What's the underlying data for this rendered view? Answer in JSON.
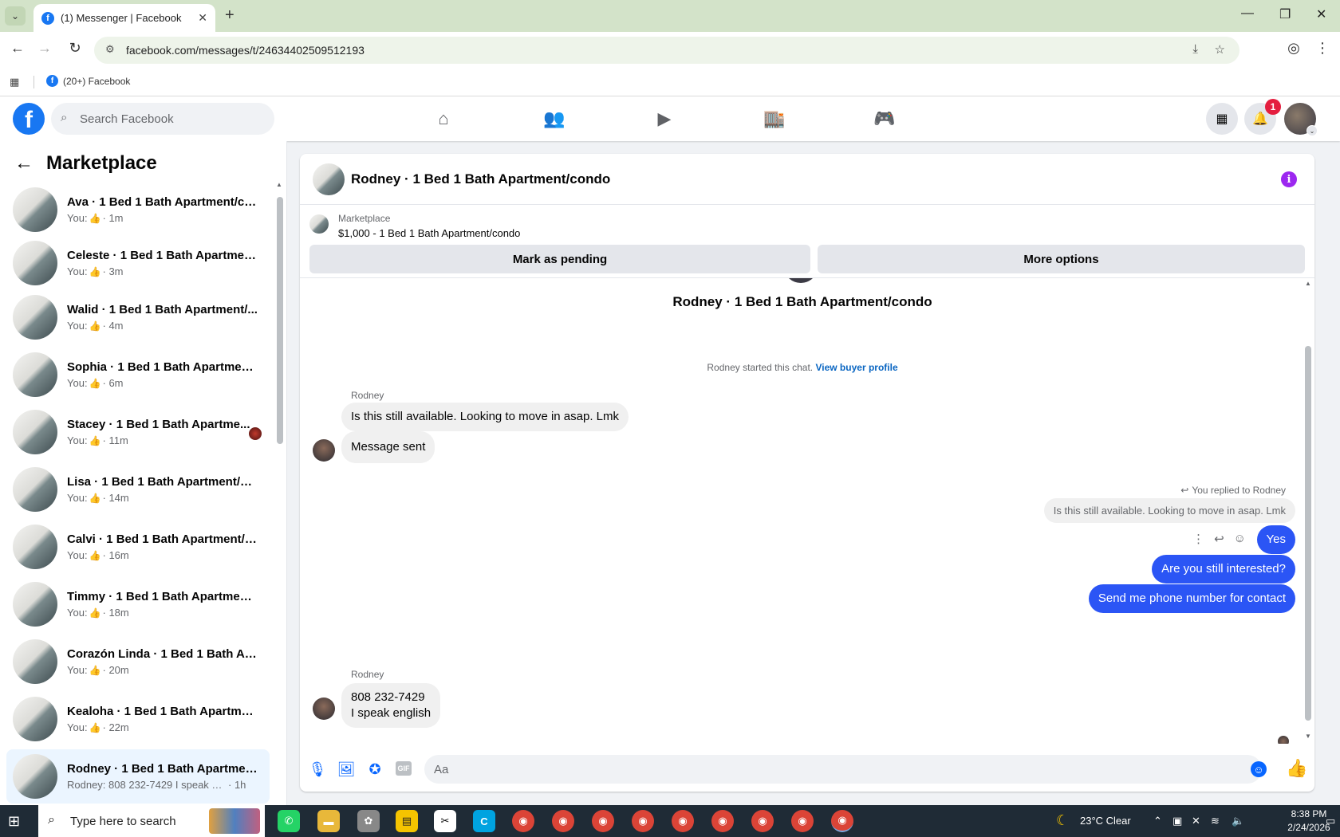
{
  "browser": {
    "tab_title": "(1) Messenger | Facebook",
    "url": "facebook.com/messages/t/24634402509512193",
    "bookmark": "(20+) Facebook"
  },
  "header": {
    "search_placeholder": "Search Facebook",
    "notification_count": "1"
  },
  "sidebar": {
    "title": "Marketplace",
    "conversations": [
      {
        "name": "Ava · 1 Bed 1 Bath Apartment/co...",
        "prefix": "You:",
        "time": "· 1m",
        "has_like": true
      },
      {
        "name": "Celeste · 1 Bed 1 Bath Apartment...",
        "prefix": "You:",
        "time": "· 3m",
        "has_like": true
      },
      {
        "name": "Walid · 1 Bed 1 Bath Apartment/...",
        "prefix": "You:",
        "time": "· 4m",
        "has_like": true
      },
      {
        "name": "Sophia · 1 Bed 1 Bath Apartment...",
        "prefix": "You:",
        "time": "· 6m",
        "has_like": true
      },
      {
        "name": "Stacey · 1 Bed 1 Bath Apartme...",
        "prefix": "You:",
        "time": "· 11m",
        "has_like": true
      },
      {
        "name": "Lisa · 1 Bed 1 Bath Apartment/co...",
        "prefix": "You:",
        "time": "· 14m",
        "has_like": true
      },
      {
        "name": "Calvi · 1 Bed 1 Bath Apartment/c...",
        "prefix": "You:",
        "time": "· 16m",
        "has_like": true
      },
      {
        "name": "Timmy · 1 Bed 1 Bath Apartment...",
        "prefix": "You:",
        "time": "· 18m",
        "has_like": true
      },
      {
        "name": "Corazón Linda · 1 Bed 1 Bath Ap...",
        "prefix": "You:",
        "time": "· 20m",
        "has_like": true
      },
      {
        "name": "Kealoha · 1 Bed 1 Bath Apartmen...",
        "prefix": "You:",
        "time": "· 22m",
        "has_like": true
      },
      {
        "name": "Rodney · 1 Bed 1 Bath Apartmen...",
        "prefix": "Rodney: 808 232-7429 I speak engl...",
        "time": "· 1h",
        "has_like": false
      }
    ]
  },
  "chat": {
    "title": "Rodney · 1 Bed 1 Bath Apartment/condo",
    "listing_category": "Marketplace",
    "listing_price": "$1,000 - 1 Bed 1 Bath Apartment/condo",
    "mark_pending_label": "Mark as pending",
    "more_options_label": "More options",
    "thread_title": "Rodney · 1 Bed 1 Bath Apartment/condo",
    "started_text": "Rodney started this chat.",
    "view_profile_label": "View buyer profile",
    "sender_name": "Rodney",
    "msg1": "Is this still available. Looking to move in asap. Lmk",
    "msg2": "Message sent",
    "reply_hint": "You replied to Rodney",
    "quoted": "Is this still available. Looking to move in asap. Lmk",
    "out1": "Yes",
    "out2": "Are you still interested?",
    "out3": "Send me phone number for contact",
    "sender_name2": "Rodney",
    "msg3_line1": "808 232-7429",
    "msg3_line2": "I speak english",
    "composer_placeholder": "Aa"
  },
  "taskbar": {
    "search_placeholder": "Type here to search",
    "weather": "23°C  Clear",
    "time": "8:38 PM",
    "date": "2/24/2026"
  },
  "colors": {
    "accent": "#0866ff",
    "outgoing_bubble": "#2b55f5",
    "fb_blue": "#1877f2"
  }
}
